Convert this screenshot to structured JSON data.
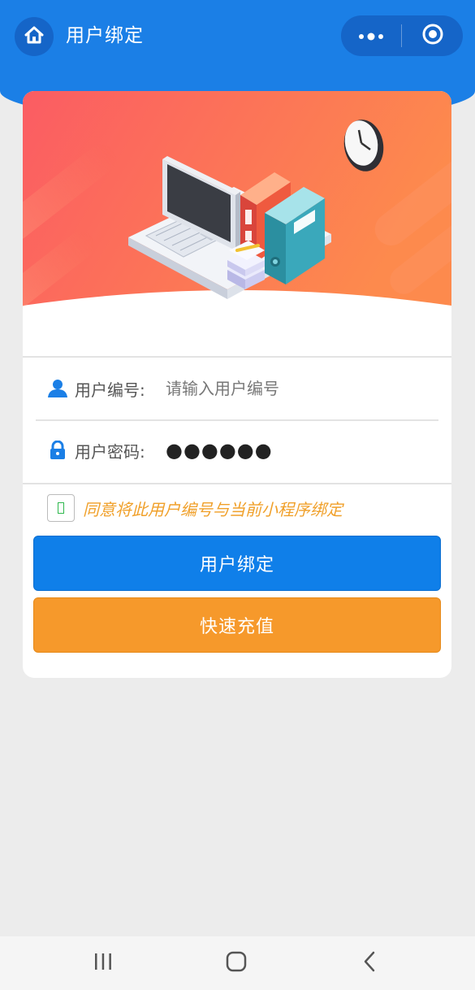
{
  "header": {
    "title": "用户绑定",
    "home_icon": "home-icon",
    "more_icon": "more-dots-icon",
    "close_icon": "target-close-icon",
    "bg_color": "#1b7fe6"
  },
  "hero": {
    "illustration": "computer-books-clock-illustration",
    "gradient_start": "#fb5c63",
    "gradient_end": "#fd8a4d"
  },
  "form": {
    "user_id": {
      "icon": "user-icon",
      "label": "用户编号:",
      "placeholder": "请输入用户编号",
      "value": ""
    },
    "password": {
      "icon": "lock-icon",
      "label": "用户密码:",
      "value": "●●●●●●"
    }
  },
  "agreement": {
    "checked": false,
    "text": "同意将此用户编号与当前小程序绑定",
    "color": "#f0a02a"
  },
  "buttons": {
    "bind_label": "用户绑定",
    "bind_color": "#0f7fe9",
    "recharge_label": "快速充值",
    "recharge_color": "#f6992b"
  },
  "navbar": {
    "recent_icon": "recent-apps-icon",
    "home_icon": "home-square-icon",
    "back_icon": "back-chevron-icon"
  }
}
